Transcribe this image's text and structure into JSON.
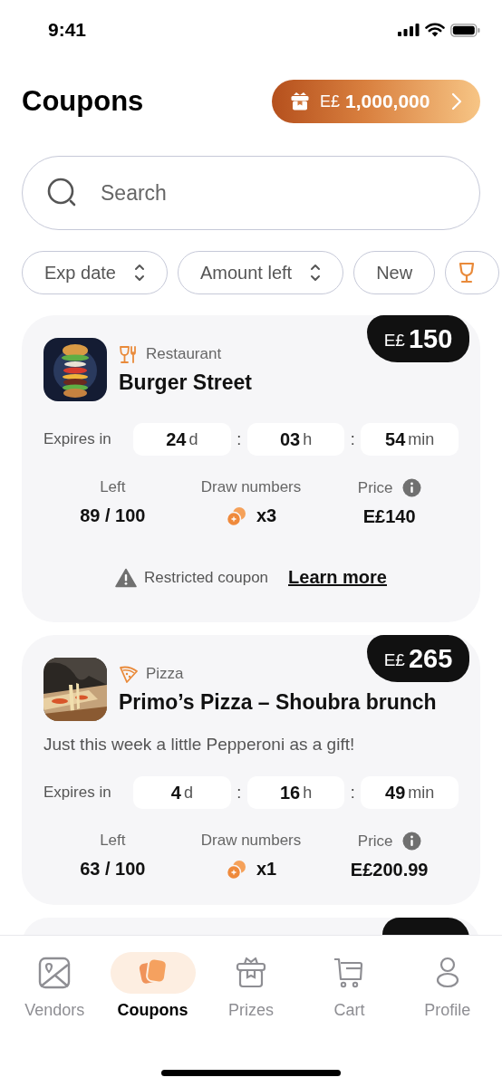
{
  "status_bar": {
    "time": "9:41"
  },
  "header": {
    "title": "Coupons",
    "balance": {
      "currency": "E£",
      "amount": "1,000,000"
    }
  },
  "search": {
    "placeholder": "Search"
  },
  "filters": [
    {
      "kind": "sort",
      "label": "Exp date"
    },
    {
      "kind": "sort",
      "label": "Amount left"
    },
    {
      "kind": "plain",
      "label": "New"
    },
    {
      "kind": "trophy"
    }
  ],
  "coupons": [
    {
      "tag_currency": "E£",
      "tag_value": "150",
      "kind": "restaurant",
      "category": "Restaurant",
      "vendor": "Burger Street",
      "expires_label": "Expires in",
      "separator": ":",
      "expiry": [
        {
          "value": "24",
          "unit": "d"
        },
        {
          "value": "03",
          "unit": "h"
        },
        {
          "value": "54",
          "unit": "min"
        }
      ],
      "stats": [
        {
          "kind": "plain",
          "label": "Left",
          "value": "89 / 100"
        },
        {
          "kind": "draws",
          "label": "Draw numbers",
          "value": "x3"
        },
        {
          "kind": "price",
          "label": "Price",
          "value": "E£140"
        }
      ],
      "restriction": {
        "text": "Restricted coupon",
        "link": "Learn more"
      }
    },
    {
      "tag_currency": "E£",
      "tag_value": "265",
      "kind": "pizza",
      "separator": ":",
      "category": "Pizza",
      "vendor": "Primo’s Pizza – Shoubra brunch",
      "description": "Just this week a little Pepperoni as a gift!",
      "expires_label": "Expires in",
      "expiry": [
        {
          "value": "4",
          "unit": "d"
        },
        {
          "value": "16",
          "unit": "h"
        },
        {
          "value": "49",
          "unit": "min"
        }
      ],
      "stats": [
        {
          "kind": "plain",
          "label": "Left",
          "value": "63 / 100"
        },
        {
          "kind": "draws",
          "label": "Draw numbers",
          "value": "x1"
        },
        {
          "kind": "price",
          "label": "Price",
          "value": "E£200.99"
        }
      ]
    }
  ],
  "more_coupons_below": true,
  "tab_bar": [
    {
      "kind": "vendors",
      "label": "Vendors",
      "selected": false
    },
    {
      "kind": "coupons",
      "label": "Coupons",
      "selected": true
    },
    {
      "kind": "prizes",
      "label": "Prizes",
      "selected": false
    },
    {
      "kind": "cart",
      "label": "Cart",
      "selected": false
    },
    {
      "kind": "profile",
      "label": "Profile",
      "selected": false
    }
  ]
}
